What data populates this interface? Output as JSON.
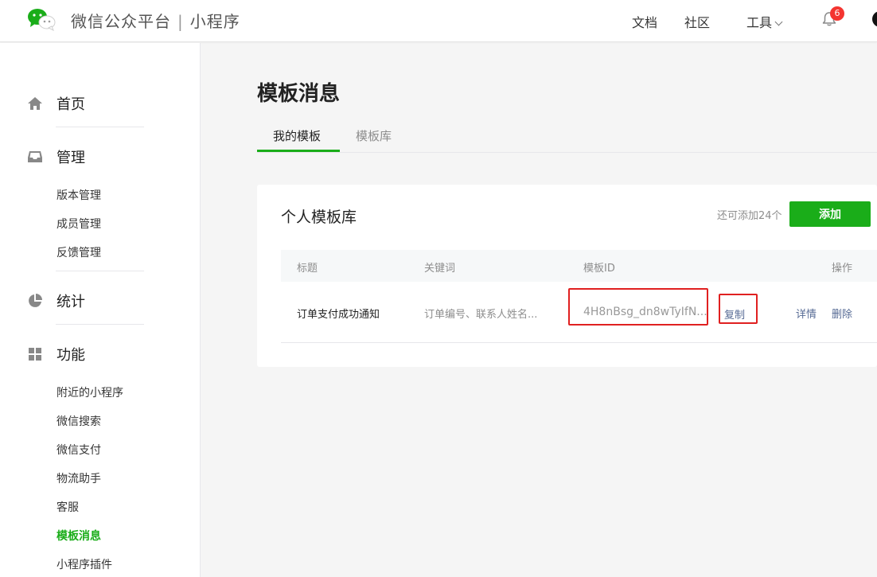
{
  "header": {
    "brand_name": "微信公众平台",
    "brand_separator": "|",
    "brand_sub": "小程序",
    "nav": {
      "docs": "文档",
      "community": "社区",
      "tools": "工具"
    },
    "notification_count": "6"
  },
  "sidebar": {
    "home": "首页",
    "manage": "管理",
    "manage_items": [
      "版本管理",
      "成员管理",
      "反馈管理"
    ],
    "stats": "统计",
    "features": "功能",
    "feature_items": [
      "附近的小程序",
      "微信搜索",
      "微信支付",
      "物流助手",
      "客服",
      "模板消息",
      "小程序插件"
    ]
  },
  "main": {
    "title": "模板消息",
    "tabs": [
      {
        "label": "我的模板",
        "active": true
      },
      {
        "label": "模板库",
        "active": false
      }
    ],
    "card": {
      "title": "个人模板库",
      "remaining": "还可添加24个",
      "add_label": "添加",
      "columns": [
        "标题",
        "关键词",
        "模板ID",
        "操作"
      ],
      "rows": [
        {
          "title": "订单支付成功通知",
          "keywords": "订单编号、联系人姓名...",
          "template_id": "4H8nBsg_dn8wTyIfN...",
          "copy": "复制",
          "detail": "详情",
          "delete": "删除"
        }
      ]
    }
  },
  "colors": {
    "accent": "#1aad19",
    "link": "#576b95",
    "highlight": "#e02020",
    "badge": "#f43530"
  }
}
